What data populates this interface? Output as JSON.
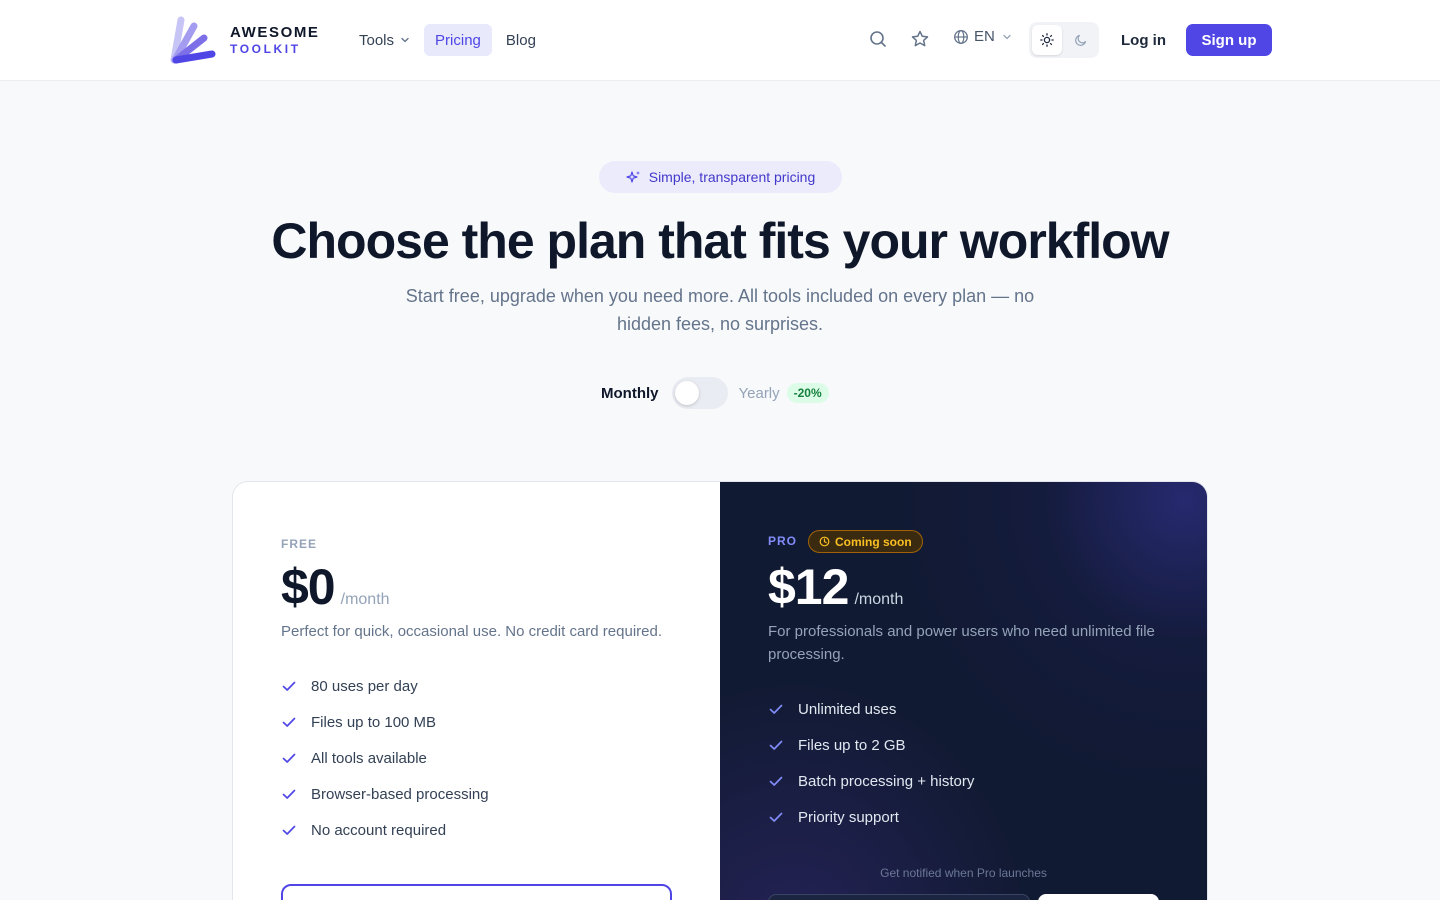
{
  "header": {
    "logo": {
      "line1": "AWESOME",
      "line2": "TOOLKIT"
    },
    "nav": [
      {
        "label": "Tools",
        "has_dropdown": true,
        "active": false
      },
      {
        "label": "Pricing",
        "active": true
      },
      {
        "label": "Blog",
        "active": false
      }
    ],
    "icons": [
      "search-icon",
      "star-icon",
      "globe-icon",
      "sun-icon",
      "moon-icon"
    ],
    "language": "EN",
    "theme_selected": "light",
    "login_label": "Log in",
    "signup_label": "Sign up"
  },
  "hero": {
    "badge": "Simple, transparent pricing",
    "title": "Choose the plan that fits your workflow",
    "subtitle": "Start free, upgrade when you need more. All tools included on every plan — no hidden fees, no surprises."
  },
  "billing": {
    "monthly_label": "Monthly",
    "yearly_label": "Yearly",
    "discount": "-20%",
    "selected": "monthly"
  },
  "plans": {
    "free": {
      "tag": "FREE",
      "price": "$0",
      "period": "/month",
      "description": "Perfect for quick, occasional use. No credit card required.",
      "features": [
        "80 uses per day",
        "Files up to 100 MB",
        "All tools available",
        "Browser-based processing",
        "No account required"
      ]
    },
    "pro": {
      "tag": "PRO",
      "badge": "Coming soon",
      "price": "$12",
      "period": "/month",
      "description": "For professionals and power users who need unlimited file processing.",
      "features": [
        "Unlimited uses",
        "Files up to 2 GB",
        "Batch processing + history",
        "Priority support"
      ],
      "notify_text": "Get notified when Pro launches"
    }
  },
  "colors": {
    "accent": "#4f46e5",
    "pro_background": "#111a33",
    "soon_badge": "#fbbf24",
    "discount_green": "#15803d"
  }
}
